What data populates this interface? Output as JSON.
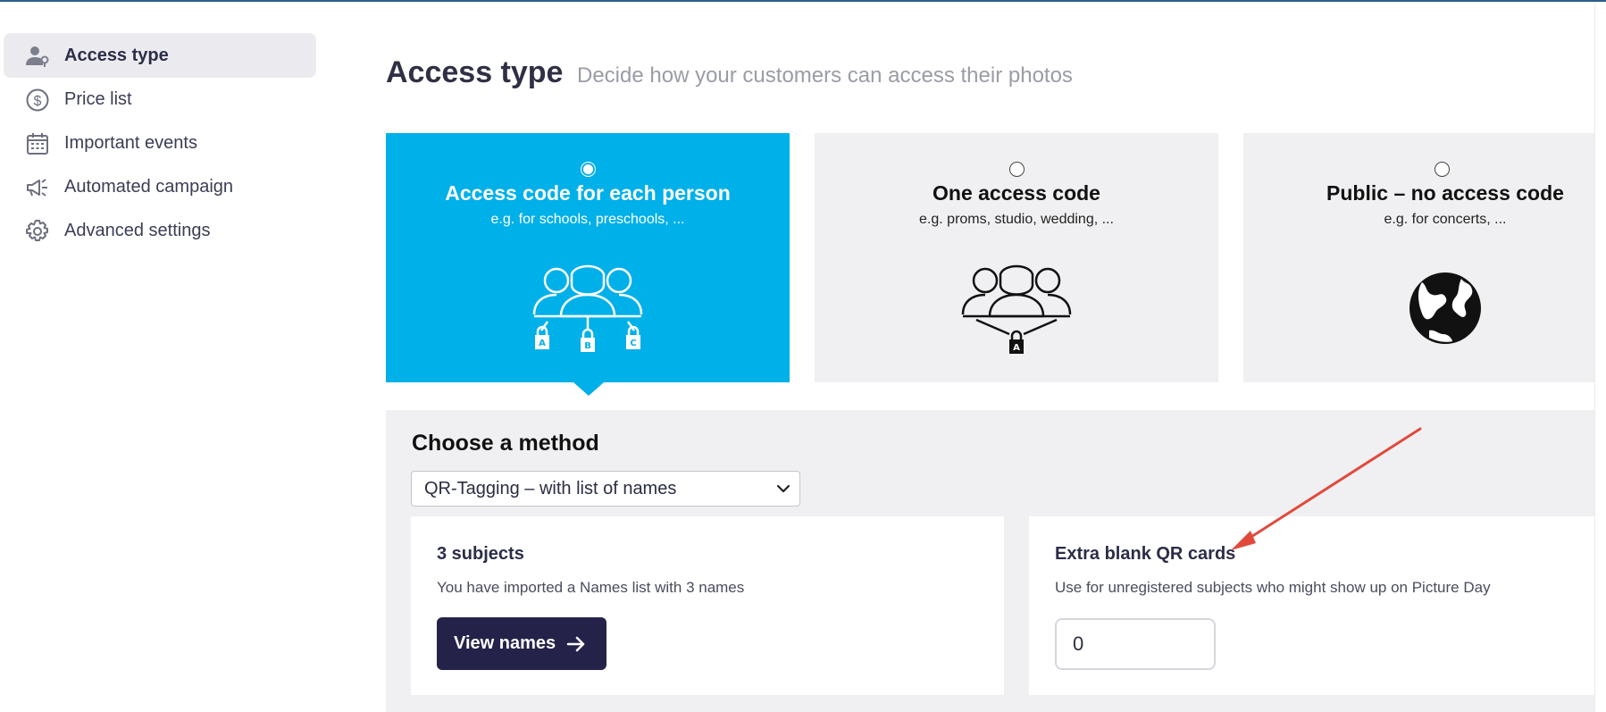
{
  "sidebar": {
    "items": [
      {
        "label": "Access type",
        "icon": "user-lock-icon",
        "active": true
      },
      {
        "label": "Price list",
        "icon": "dollar-circle-icon",
        "active": false
      },
      {
        "label": "Important events",
        "icon": "calendar-icon",
        "active": false
      },
      {
        "label": "Automated campaign",
        "icon": "megaphone-icon",
        "active": false
      },
      {
        "label": "Advanced settings",
        "icon": "gear-icon",
        "active": false
      }
    ]
  },
  "header": {
    "title": "Access type",
    "subtitle": "Decide how your customers can access their photos"
  },
  "cards": [
    {
      "title": "Access code for each person",
      "desc": "e.g. for schools, preschools, ...",
      "icon": "group-multiple-locks-icon",
      "selected": true
    },
    {
      "title": "One access code",
      "desc": "e.g. proms, studio, wedding, ...",
      "icon": "group-single-lock-icon",
      "selected": false
    },
    {
      "title": "Public – no access code",
      "desc": "e.g. for concerts, ...",
      "icon": "globe-icon",
      "selected": false
    }
  ],
  "method": {
    "title": "Choose a method",
    "selected": "QR-Tagging – with list of names"
  },
  "subjects": {
    "title": "3 subjects",
    "desc": "You have imported a Names list with 3 names",
    "button": "View names"
  },
  "extra": {
    "title": "Extra blank QR cards",
    "desc": "Use for unregistered subjects who might show up on Picture Day",
    "value": "0"
  },
  "colors": {
    "accent": "#00b0e8",
    "button": "#25224a",
    "annotation_arrow": "#e04a3c"
  }
}
